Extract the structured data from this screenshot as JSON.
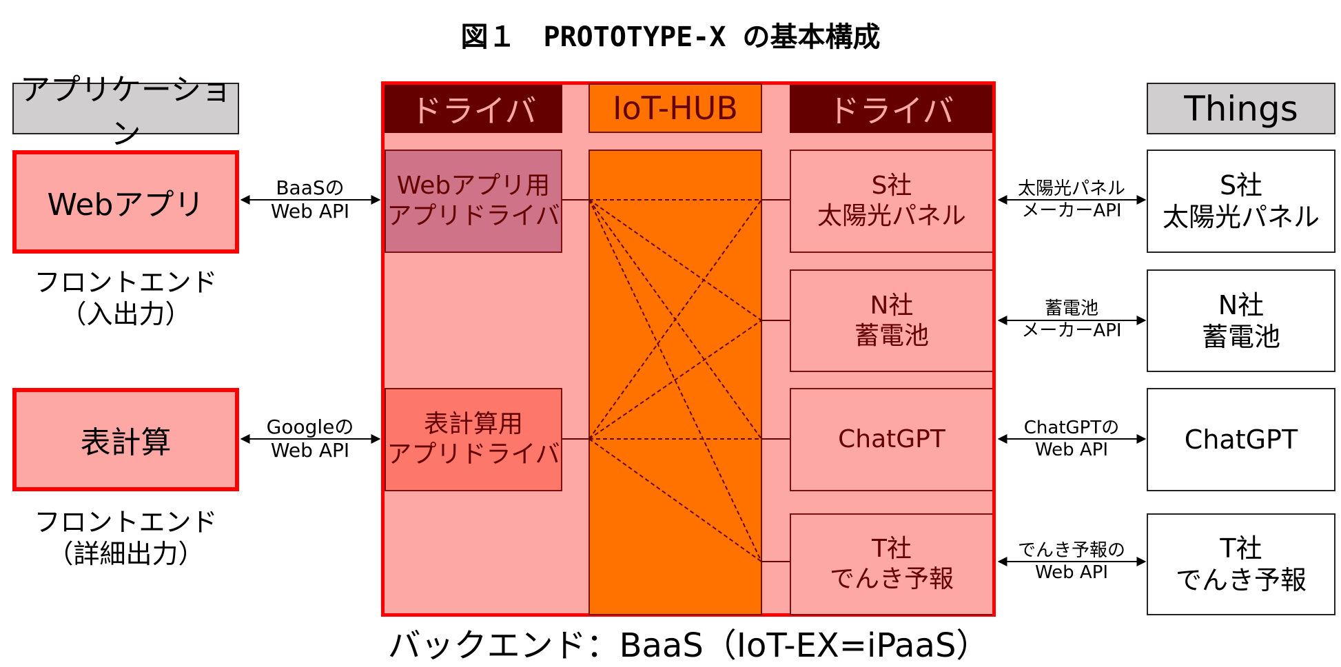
{
  "title": "図１　PROTOTYPE-X の基本構成",
  "colors": {
    "backend_border": "#ff0000",
    "backend_fill": "#fea8a5",
    "driver_header": "#640000",
    "hub": "#ff7200",
    "web_app_driver": "#cf7389",
    "sheet_app_driver": "#fd786b",
    "header_gray": "#d0cecf",
    "line": "#640000"
  },
  "applications": {
    "header": "アプリケーション",
    "items": [
      {
        "label": "Webアプリ",
        "caption_line1": "フロントエンド",
        "caption_line2": "（入出力）",
        "api_line1": "BaaSの",
        "api_line2": "Web API"
      },
      {
        "label": "表計算",
        "caption_line1": "フロントエンド",
        "caption_line2": "（詳細出力）",
        "api_line1": "Googleの",
        "api_line2": "Web API"
      }
    ]
  },
  "backend": {
    "left_driver_header": "ドライバ",
    "hub_header": "IoT-HUB",
    "right_driver_header": "ドライバ",
    "app_drivers": [
      {
        "line1": "Webアプリ用",
        "line2": "アプリドライバ"
      },
      {
        "line1": "表計算用",
        "line2": "アプリドライバ"
      }
    ],
    "device_drivers": [
      {
        "line1": "S社",
        "line2": "太陽光パネル"
      },
      {
        "line1": "N社",
        "line2": "蓄電池"
      },
      {
        "line1": "ChatGPT",
        "line2": ""
      },
      {
        "line1": "T社",
        "line2": "でんき予報"
      }
    ],
    "footer": "バックエンド：BaaS（IoT-EX=iPaaS）"
  },
  "things": {
    "header": "Things",
    "items": [
      {
        "line1": "S社",
        "line2": "太陽光パネル",
        "api_line1": "太陽光パネル",
        "api_line2": "メーカーAPI"
      },
      {
        "line1": "N社",
        "line2": "蓄電池",
        "api_line1": "蓄電池",
        "api_line2": "メーカーAPI"
      },
      {
        "line1": "ChatGPT",
        "line2": "",
        "api_line1": "ChatGPTの",
        "api_line2": "Web API"
      },
      {
        "line1": "T社",
        "line2": "でんき予報",
        "api_line1": "でんき予報の",
        "api_line2": "Web API"
      }
    ]
  },
  "hub_connections": [
    {
      "from": "app_driver_0",
      "to": "device_driver_0"
    },
    {
      "from": "app_driver_0",
      "to": "device_driver_1"
    },
    {
      "from": "app_driver_0",
      "to": "device_driver_2"
    },
    {
      "from": "app_driver_0",
      "to": "device_driver_3"
    },
    {
      "from": "app_driver_1",
      "to": "device_driver_0"
    },
    {
      "from": "app_driver_1",
      "to": "device_driver_1"
    },
    {
      "from": "app_driver_1",
      "to": "device_driver_2"
    },
    {
      "from": "app_driver_1",
      "to": "device_driver_3"
    }
  ]
}
